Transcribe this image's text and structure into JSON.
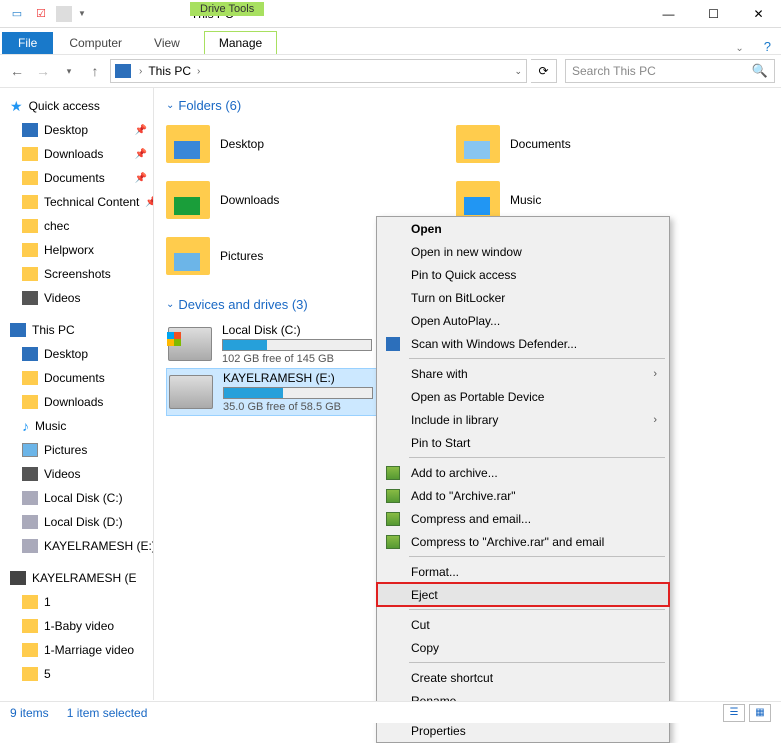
{
  "window": {
    "title": "This PC",
    "min_tip": "Minimize",
    "max_tip": "Maximize",
    "close_tip": "Close"
  },
  "ribbon": {
    "file": "File",
    "computer": "Computer",
    "view": "View",
    "drive_tools": "Drive Tools",
    "manage": "Manage"
  },
  "nav": {
    "crumb_root": "This PC",
    "search_placeholder": "Search This PC"
  },
  "sidebar": {
    "quick_access": "Quick access",
    "qa_items": [
      {
        "label": "Desktop",
        "pinned": true
      },
      {
        "label": "Downloads",
        "pinned": true
      },
      {
        "label": "Documents",
        "pinned": true
      },
      {
        "label": "Technical Content",
        "pinned": true
      },
      {
        "label": "chec",
        "pinned": false
      },
      {
        "label": "Helpworx",
        "pinned": false
      },
      {
        "label": "Screenshots",
        "pinned": false
      },
      {
        "label": "Videos",
        "pinned": false
      }
    ],
    "this_pc": "This PC",
    "pc_items": [
      {
        "label": "Desktop"
      },
      {
        "label": "Documents"
      },
      {
        "label": "Downloads"
      },
      {
        "label": "Music"
      },
      {
        "label": "Pictures"
      },
      {
        "label": "Videos"
      },
      {
        "label": "Local Disk (C:)"
      },
      {
        "label": "Local Disk (D:)"
      },
      {
        "label": "KAYELRAMESH (E:)"
      }
    ],
    "ext_drive": "KAYELRAMESH (E",
    "ext_items": [
      {
        "label": "1"
      },
      {
        "label": "1-Baby video"
      },
      {
        "label": "1-Marriage video"
      },
      {
        "label": "5"
      }
    ]
  },
  "main": {
    "folders_header": "Folders (6)",
    "folders": [
      {
        "label": "Desktop"
      },
      {
        "label": "Documents"
      },
      {
        "label": "Downloads"
      },
      {
        "label": "Music"
      },
      {
        "label": "Pictures"
      }
    ],
    "drives_header": "Devices and drives (3)",
    "drives": [
      {
        "name": "Local Disk (C:)",
        "free": "102 GB free of 145 GB",
        "pct": 30
      },
      {
        "name": "KAYELRAMESH (E:)",
        "free": "35.0 GB free of 58.5 GB",
        "pct": 40
      }
    ]
  },
  "ctx": {
    "open": "Open",
    "open_new": "Open in new window",
    "pin_qa": "Pin to Quick access",
    "bitlocker": "Turn on BitLocker",
    "autoplay": "Open AutoPlay...",
    "scan": "Scan with Windows Defender...",
    "share": "Share with",
    "portable": "Open as Portable Device",
    "library": "Include in library",
    "pin_start": "Pin to Start",
    "add_archive": "Add to archive...",
    "add_rar": "Add to \"Archive.rar\"",
    "compress_email": "Compress and email...",
    "compress_rar_email": "Compress to \"Archive.rar\" and email",
    "format": "Format...",
    "eject": "Eject",
    "cut": "Cut",
    "copy": "Copy",
    "shortcut": "Create shortcut",
    "rename": "Rename",
    "properties": "Properties"
  },
  "status": {
    "items": "9 items",
    "selected": "1 item selected"
  }
}
